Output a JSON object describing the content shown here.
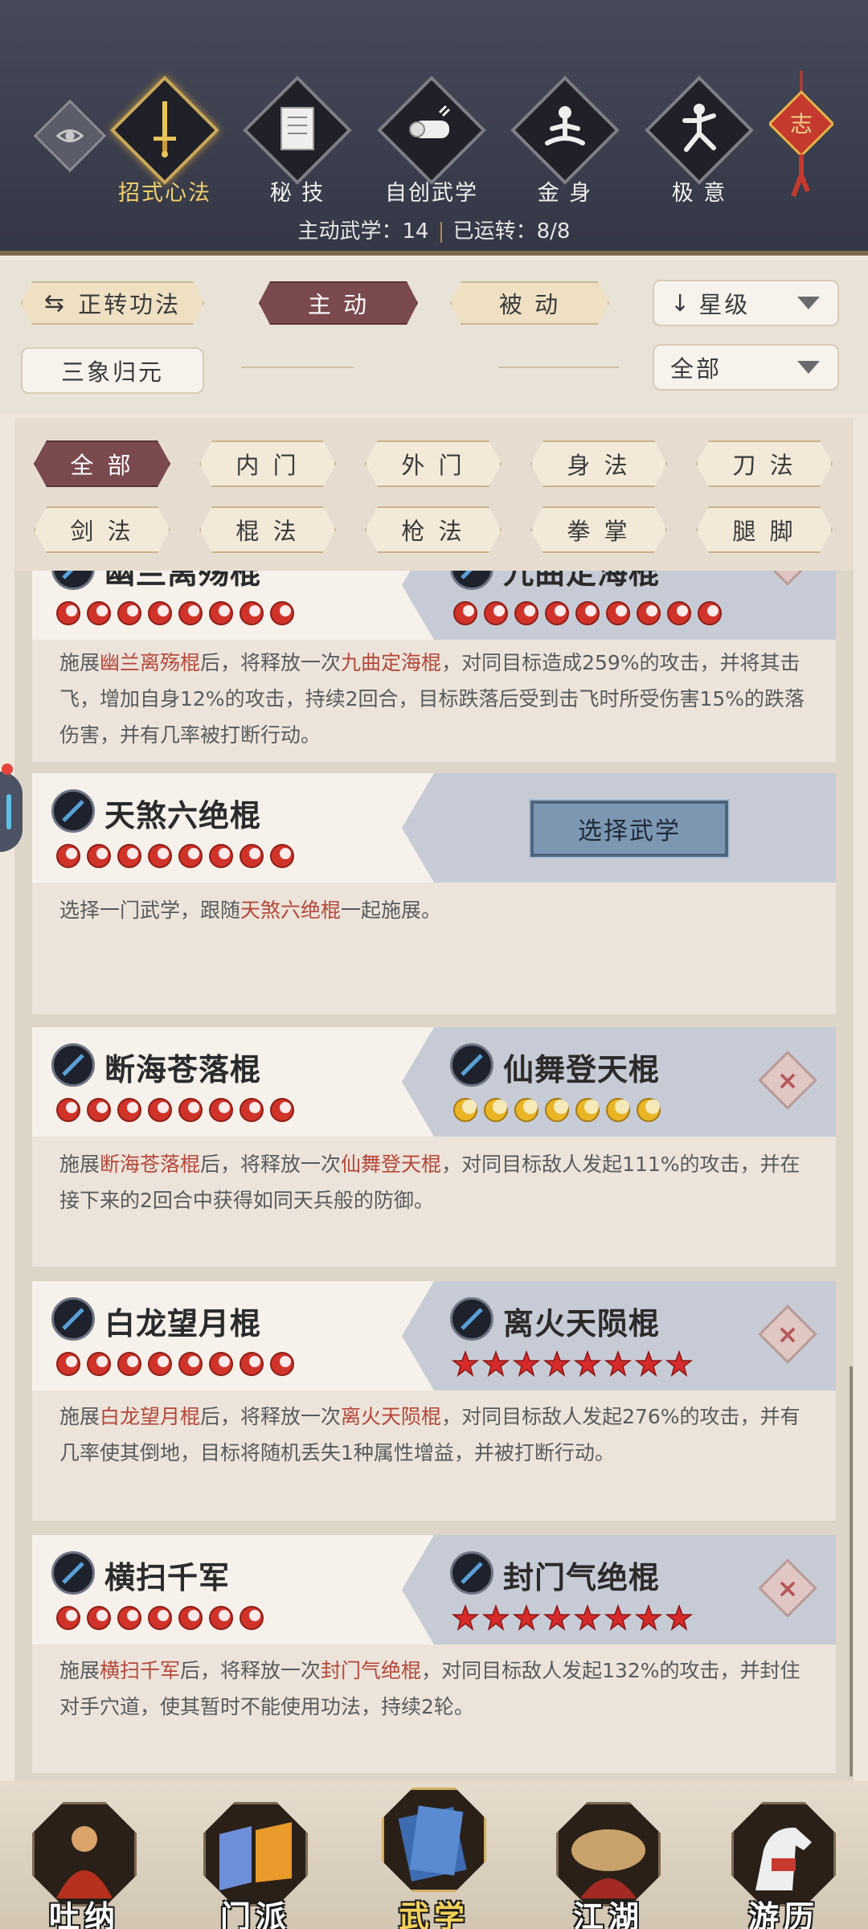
{
  "top_tabs": [
    {
      "label": "招式心法",
      "icon": "sword-icon",
      "active": true
    },
    {
      "label": "秘 技",
      "icon": "book-icon",
      "active": false
    },
    {
      "label": "自创武学",
      "icon": "scroll-icon",
      "active": false
    },
    {
      "label": "金 身",
      "icon": "meditation-icon",
      "active": false
    },
    {
      "label": "极 意",
      "icon": "martial-stance-icon",
      "active": false
    }
  ],
  "knot_label": "志",
  "stats": {
    "active_label": "主动武学：14",
    "running_label": "已运转：8/8"
  },
  "filters": {
    "switch_label": "正转功法",
    "active_label": "主 动",
    "passive_label": "被 动",
    "sort_label": "星级",
    "sanxiang_label": "三象归元",
    "scope_label": "全部"
  },
  "categories": [
    "全 部",
    "内 门",
    "外 门",
    "身 法",
    "刀 法",
    "剑 法",
    "棍 法",
    "枪 法",
    "拳 掌",
    "腿 脚"
  ],
  "cards": [
    {
      "left_name": "幽兰离殇棍",
      "left_stars": 8,
      "right_name": "九曲定海棍",
      "right_stars": 9,
      "right_star_type": "flame",
      "desc_parts": [
        "施展",
        "幽兰离殇棍",
        "后，将释放一次",
        "九曲定海棍",
        "，对同目标造成259%的攻击，并将其击飞，增加自身12%的攻击，持续2回合，目标跌落后受到击飞时所受伤害15%的跌落伤害，并有几率被打断行动。"
      ]
    },
    {
      "left_name": "天煞六绝棍",
      "left_stars": 8,
      "button_label": "选择武学",
      "desc_parts": [
        "选择一门武学，跟随",
        "天煞六绝棍",
        "一起施展。"
      ]
    },
    {
      "left_name": "断海苍落棍",
      "left_stars": 8,
      "right_name": "仙舞登天棍",
      "right_stars": 7,
      "right_star_type": "moon",
      "desc_parts": [
        "施展",
        "断海苍落棍",
        "后，将释放一次",
        "仙舞登天棍",
        "，对同目标敌人发起111%的攻击，并在接下来的2回合中获得如同天兵般的防御。"
      ]
    },
    {
      "left_name": "白龙望月棍",
      "left_stars": 8,
      "right_name": "离火天陨棍",
      "right_stars": 8,
      "right_star_type": "star",
      "desc_parts": [
        "施展",
        "白龙望月棍",
        "后，将释放一次",
        "离火天陨棍",
        "，对同目标敌人发起276%的攻击，并有几率使其倒地，目标将随机丢失1种属性增益，并被打断行动。"
      ]
    },
    {
      "left_name": "横扫千军",
      "left_stars": 7,
      "right_name": "封门气绝棍",
      "right_stars": 8,
      "right_star_type": "star",
      "desc_parts": [
        "施展",
        "横扫千军",
        "后，将释放一次",
        "封门气绝棍",
        "，对同目标敌人发起132%的攻击，并封住对手穴道，使其暂时不能使用功法，持续2轮。"
      ]
    }
  ],
  "bottom_nav": [
    {
      "label": "吐纳",
      "active": false
    },
    {
      "label": "门派",
      "active": false
    },
    {
      "label": "武学",
      "active": true
    },
    {
      "label": "江湖",
      "active": false
    },
    {
      "label": "游历",
      "active": false
    }
  ],
  "colors": {
    "accent_red": "#b5473a",
    "active_pill": "#7b4a4e",
    "gold": "#f1d16a",
    "header_bg": "#3e4150"
  }
}
